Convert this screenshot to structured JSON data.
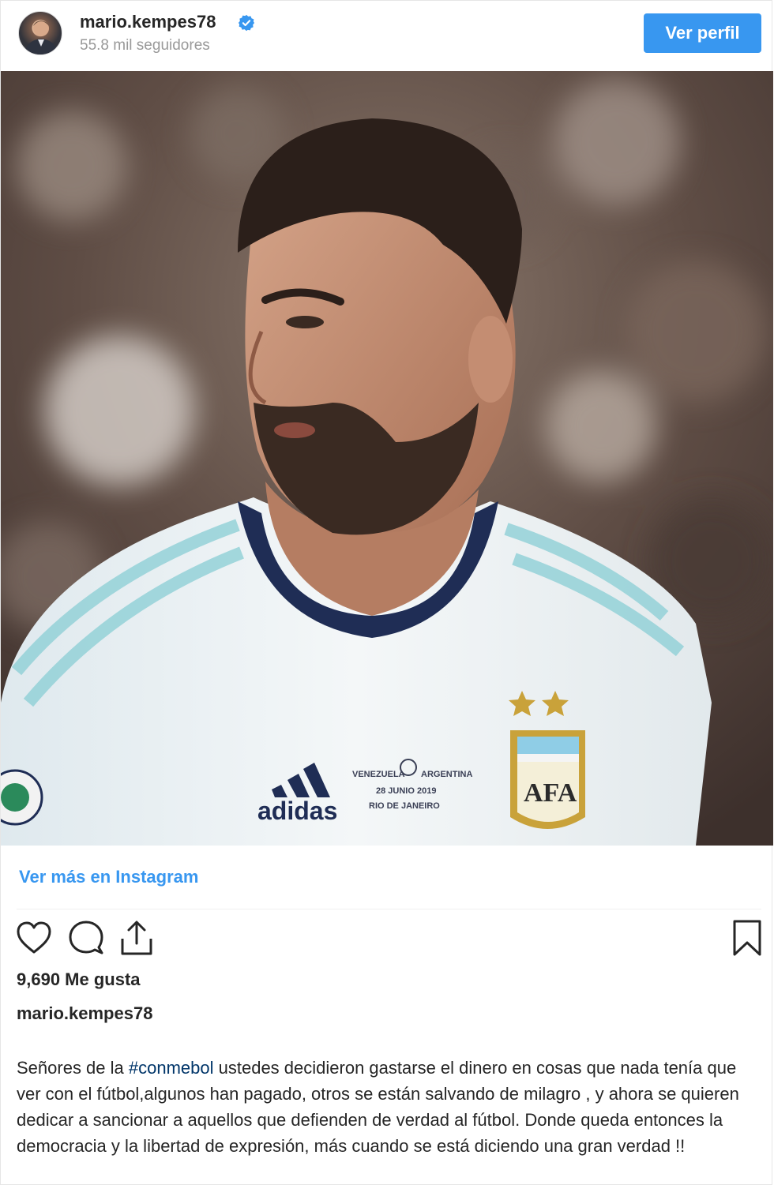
{
  "header": {
    "username": "mario.kempes78",
    "followers": "55.8 mil seguidores",
    "profile_button": "Ver perfil"
  },
  "post": {
    "view_more_link": "Ver más en Instagram",
    "likes": "9,690 Me gusta",
    "author": "mario.kempes78",
    "caption_before": "Señores de la ",
    "caption_hashtag": "#conmebol",
    "caption_after": " ustedes decidieron gastarse el dinero en cosas que nada tenía que ver con el fútbol,algunos han pagado, otros se están salvando de milagro , y ahora se quieren dedicar a sancionar a aquellos que defienden de verdad al fútbol. Donde queda entonces la democracia y la libertad de expresión, más cuando se está diciendo una gran verdad !!"
  },
  "jersey": {
    "brand": "adidas",
    "match_line_1": "VENEZUELA",
    "match_line_1b": "ARGENTINA",
    "match_line_2": "28 JUNIO 2019",
    "match_line_3": "RIO DE JANEIRO",
    "crest": "AFA"
  },
  "icons": [
    "verified-badge-icon",
    "heart-icon",
    "comment-icon",
    "share-icon",
    "bookmark-icon"
  ],
  "colors": {
    "accent": "#3897f0",
    "hashtag": "#003569",
    "text": "#262626",
    "muted": "#999999"
  }
}
